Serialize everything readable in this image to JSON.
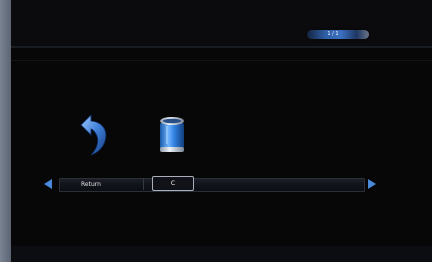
{
  "header": {
    "page_indicator": "1 / 1"
  },
  "icons": {
    "return": "return-arrow-icon",
    "delete": "trash-can-icon"
  },
  "selector": {
    "label": "Return",
    "value": "C"
  },
  "colors": {
    "screen_background": "#070707",
    "accent_blue": "#4a8ad8",
    "pill_blue": "#3b6fbf"
  }
}
